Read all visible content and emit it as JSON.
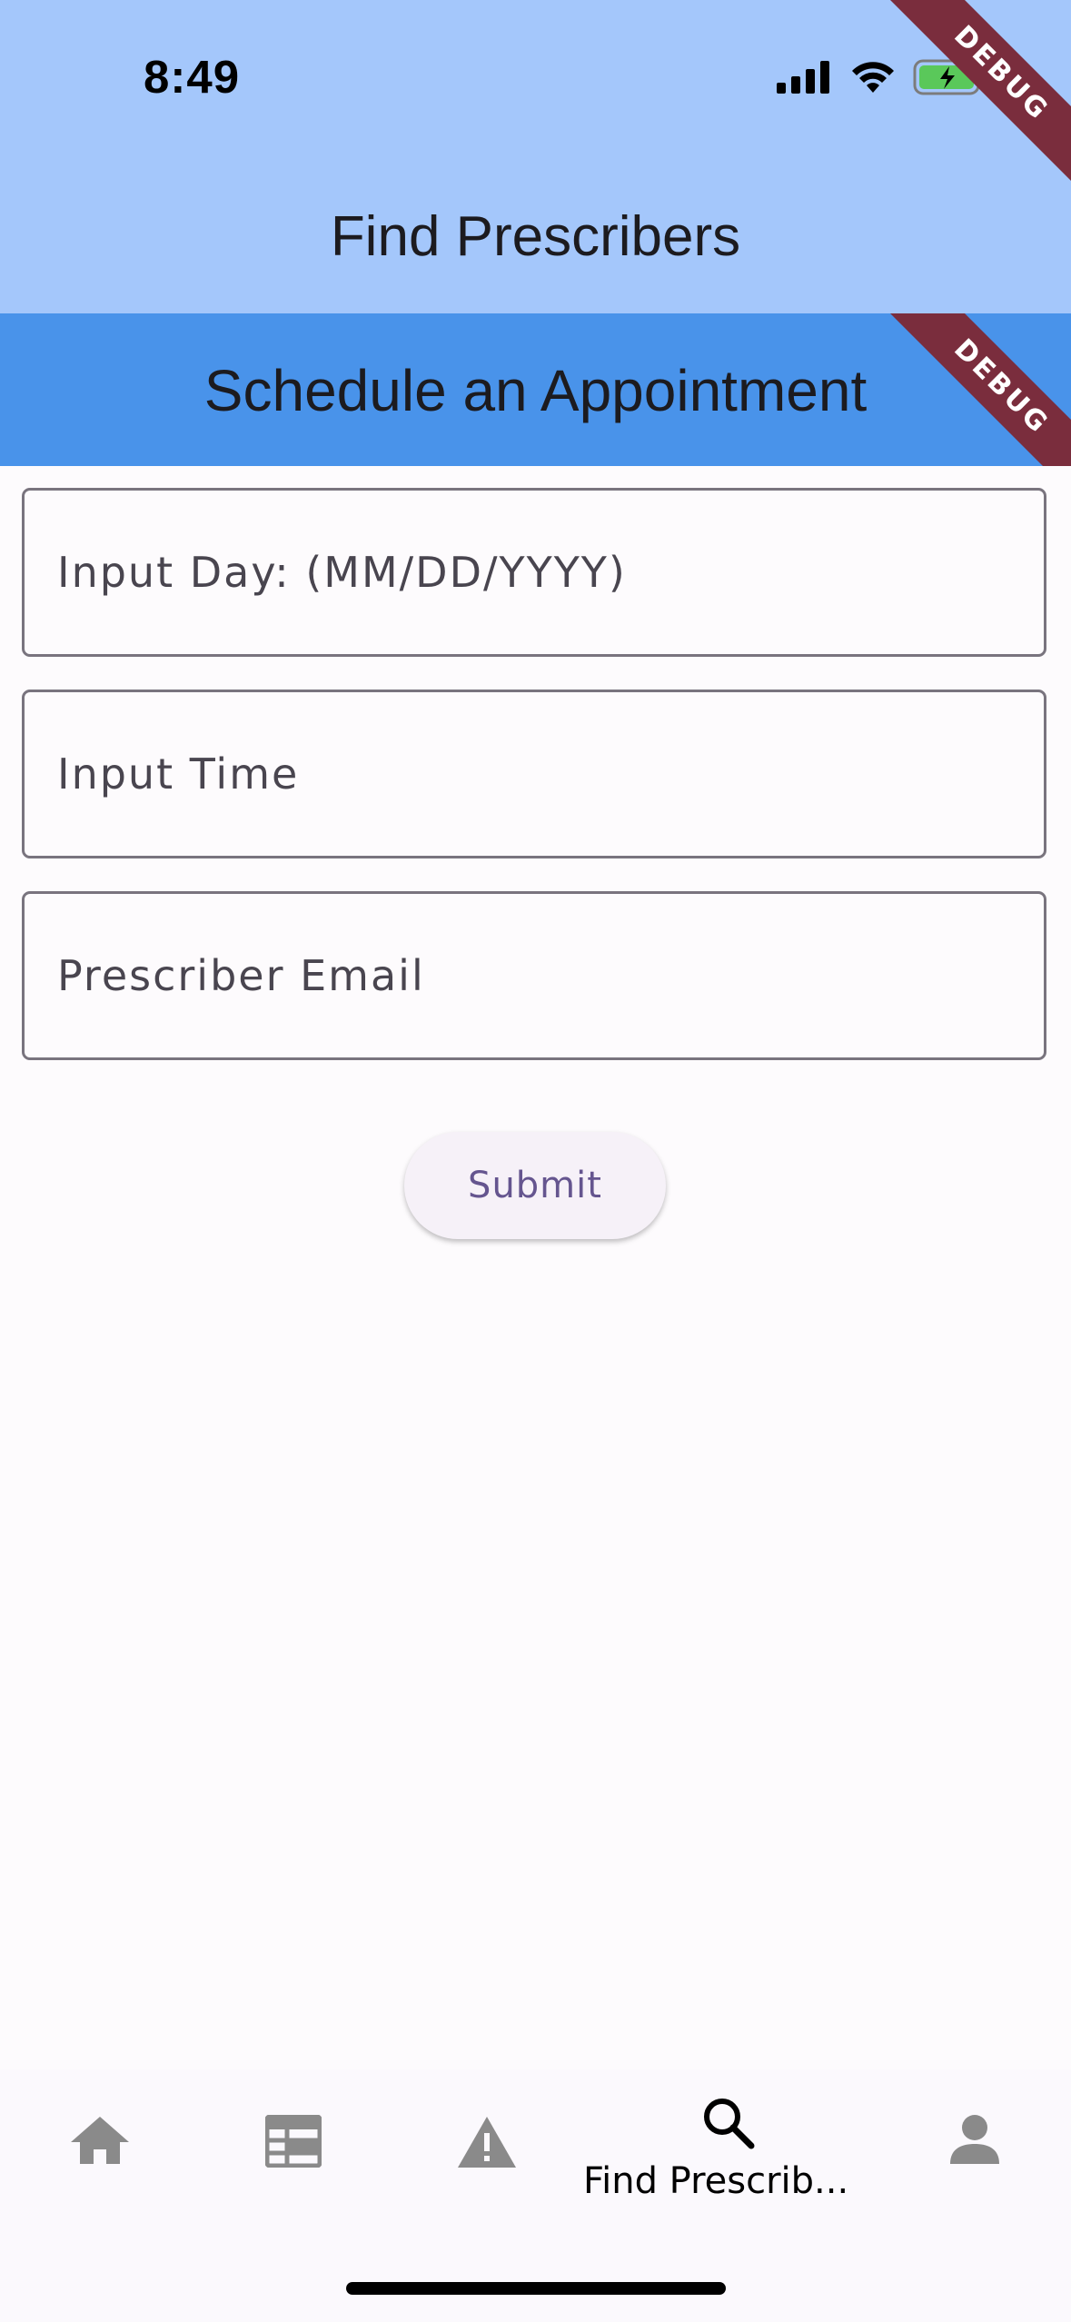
{
  "status_bar": {
    "time": "8:49"
  },
  "debug_banner": "DEBUG",
  "outer_app_bar": {
    "title": "Find Prescribers"
  },
  "inner_app_bar": {
    "title": "Schedule an Appointment"
  },
  "form": {
    "day_placeholder": "Input Day: (MM/DD/YYYY)",
    "time_placeholder": "Input Time",
    "email_placeholder": "Prescriber Email",
    "submit_label": "Submit"
  },
  "bottom_nav": {
    "items": [
      {
        "icon": "home-icon",
        "label": ""
      },
      {
        "icon": "table-icon",
        "label": ""
      },
      {
        "icon": "warning-icon",
        "label": ""
      },
      {
        "icon": "search-icon",
        "label": "Find Prescrib...",
        "selected": true
      },
      {
        "icon": "person-icon",
        "label": ""
      }
    ]
  },
  "colors": {
    "outer_bar": "#a4c7fb",
    "inner_bar": "#4993ea",
    "accent_text": "#65558f",
    "inactive_icon": "#8a8a8a"
  }
}
